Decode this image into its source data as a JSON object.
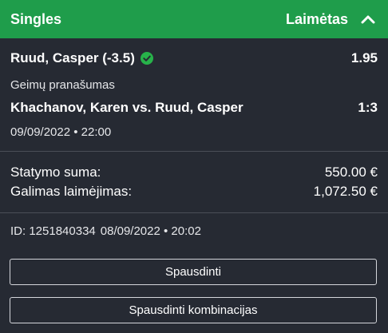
{
  "header": {
    "title": "Singles",
    "status": "Laimėtas",
    "accent_color": "#1f9d4b",
    "toggle_icon": "chevron-up-icon"
  },
  "selection": {
    "name": "Ruud, Casper (-3.5)",
    "status_icon": "check-circle-icon",
    "status_color": "#27b24a",
    "odds": "1.95",
    "market": "Geimų pranašumas",
    "match": "Khachanov, Karen vs. Ruud, Casper",
    "score": "1:3",
    "datetime": "09/09/2022 • 22:00"
  },
  "summary": {
    "stake_label": "Statymo suma:",
    "stake_value": "550.00 €",
    "win_label": "Galimas laimėjimas:",
    "win_value": "1,072.50 €"
  },
  "meta": {
    "id": "ID: 1251840334",
    "placed": "08/09/2022 • 20:02"
  },
  "buttons": {
    "print_label": "Spausdinti",
    "print_combo_label": "Spausdinti kombinacijas"
  }
}
